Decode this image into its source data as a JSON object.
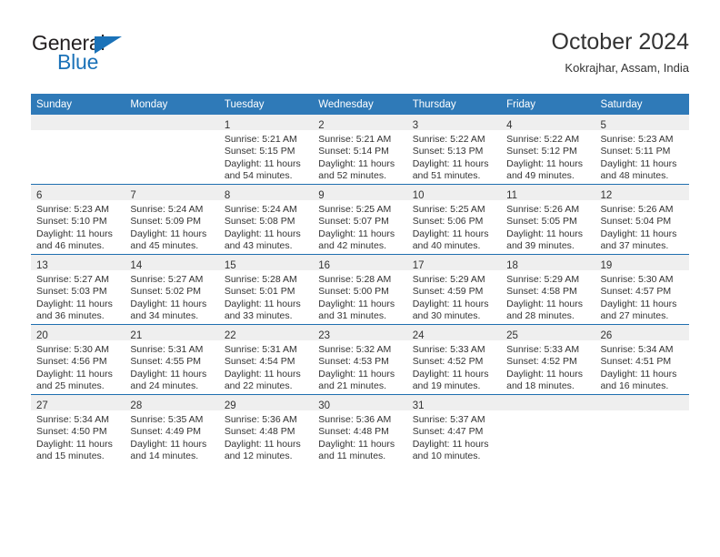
{
  "brand": {
    "name_part1": "General",
    "name_part2": "Blue",
    "triangle_icon": "brand-triangle-icon",
    "accent_color": "#1b72b8"
  },
  "header": {
    "title": "October 2024",
    "subtitle": "Kokrajhar, Assam, India"
  },
  "colors": {
    "header_blue": "#2f7ab8",
    "row_divider_blue": "#1f6fb0",
    "daynum_band_gray": "#efefef",
    "text": "#333333"
  },
  "weekday_headers": [
    "Sunday",
    "Monday",
    "Tuesday",
    "Wednesday",
    "Thursday",
    "Friday",
    "Saturday"
  ],
  "weeks": [
    [
      {
        "day": "",
        "empty": true
      },
      {
        "day": "",
        "empty": true
      },
      {
        "day": "1",
        "sunrise": "Sunrise: 5:21 AM",
        "sunset": "Sunset: 5:15 PM",
        "daylight": "Daylight: 11 hours and 54 minutes."
      },
      {
        "day": "2",
        "sunrise": "Sunrise: 5:21 AM",
        "sunset": "Sunset: 5:14 PM",
        "daylight": "Daylight: 11 hours and 52 minutes."
      },
      {
        "day": "3",
        "sunrise": "Sunrise: 5:22 AM",
        "sunset": "Sunset: 5:13 PM",
        "daylight": "Daylight: 11 hours and 51 minutes."
      },
      {
        "day": "4",
        "sunrise": "Sunrise: 5:22 AM",
        "sunset": "Sunset: 5:12 PM",
        "daylight": "Daylight: 11 hours and 49 minutes."
      },
      {
        "day": "5",
        "sunrise": "Sunrise: 5:23 AM",
        "sunset": "Sunset: 5:11 PM",
        "daylight": "Daylight: 11 hours and 48 minutes."
      }
    ],
    [
      {
        "day": "6",
        "sunrise": "Sunrise: 5:23 AM",
        "sunset": "Sunset: 5:10 PM",
        "daylight": "Daylight: 11 hours and 46 minutes."
      },
      {
        "day": "7",
        "sunrise": "Sunrise: 5:24 AM",
        "sunset": "Sunset: 5:09 PM",
        "daylight": "Daylight: 11 hours and 45 minutes."
      },
      {
        "day": "8",
        "sunrise": "Sunrise: 5:24 AM",
        "sunset": "Sunset: 5:08 PM",
        "daylight": "Daylight: 11 hours and 43 minutes."
      },
      {
        "day": "9",
        "sunrise": "Sunrise: 5:25 AM",
        "sunset": "Sunset: 5:07 PM",
        "daylight": "Daylight: 11 hours and 42 minutes."
      },
      {
        "day": "10",
        "sunrise": "Sunrise: 5:25 AM",
        "sunset": "Sunset: 5:06 PM",
        "daylight": "Daylight: 11 hours and 40 minutes."
      },
      {
        "day": "11",
        "sunrise": "Sunrise: 5:26 AM",
        "sunset": "Sunset: 5:05 PM",
        "daylight": "Daylight: 11 hours and 39 minutes."
      },
      {
        "day": "12",
        "sunrise": "Sunrise: 5:26 AM",
        "sunset": "Sunset: 5:04 PM",
        "daylight": "Daylight: 11 hours and 37 minutes."
      }
    ],
    [
      {
        "day": "13",
        "sunrise": "Sunrise: 5:27 AM",
        "sunset": "Sunset: 5:03 PM",
        "daylight": "Daylight: 11 hours and 36 minutes."
      },
      {
        "day": "14",
        "sunrise": "Sunrise: 5:27 AM",
        "sunset": "Sunset: 5:02 PM",
        "daylight": "Daylight: 11 hours and 34 minutes."
      },
      {
        "day": "15",
        "sunrise": "Sunrise: 5:28 AM",
        "sunset": "Sunset: 5:01 PM",
        "daylight": "Daylight: 11 hours and 33 minutes."
      },
      {
        "day": "16",
        "sunrise": "Sunrise: 5:28 AM",
        "sunset": "Sunset: 5:00 PM",
        "daylight": "Daylight: 11 hours and 31 minutes."
      },
      {
        "day": "17",
        "sunrise": "Sunrise: 5:29 AM",
        "sunset": "Sunset: 4:59 PM",
        "daylight": "Daylight: 11 hours and 30 minutes."
      },
      {
        "day": "18",
        "sunrise": "Sunrise: 5:29 AM",
        "sunset": "Sunset: 4:58 PM",
        "daylight": "Daylight: 11 hours and 28 minutes."
      },
      {
        "day": "19",
        "sunrise": "Sunrise: 5:30 AM",
        "sunset": "Sunset: 4:57 PM",
        "daylight": "Daylight: 11 hours and 27 minutes."
      }
    ],
    [
      {
        "day": "20",
        "sunrise": "Sunrise: 5:30 AM",
        "sunset": "Sunset: 4:56 PM",
        "daylight": "Daylight: 11 hours and 25 minutes."
      },
      {
        "day": "21",
        "sunrise": "Sunrise: 5:31 AM",
        "sunset": "Sunset: 4:55 PM",
        "daylight": "Daylight: 11 hours and 24 minutes."
      },
      {
        "day": "22",
        "sunrise": "Sunrise: 5:31 AM",
        "sunset": "Sunset: 4:54 PM",
        "daylight": "Daylight: 11 hours and 22 minutes."
      },
      {
        "day": "23",
        "sunrise": "Sunrise: 5:32 AM",
        "sunset": "Sunset: 4:53 PM",
        "daylight": "Daylight: 11 hours and 21 minutes."
      },
      {
        "day": "24",
        "sunrise": "Sunrise: 5:33 AM",
        "sunset": "Sunset: 4:52 PM",
        "daylight": "Daylight: 11 hours and 19 minutes."
      },
      {
        "day": "25",
        "sunrise": "Sunrise: 5:33 AM",
        "sunset": "Sunset: 4:52 PM",
        "daylight": "Daylight: 11 hours and 18 minutes."
      },
      {
        "day": "26",
        "sunrise": "Sunrise: 5:34 AM",
        "sunset": "Sunset: 4:51 PM",
        "daylight": "Daylight: 11 hours and 16 minutes."
      }
    ],
    [
      {
        "day": "27",
        "sunrise": "Sunrise: 5:34 AM",
        "sunset": "Sunset: 4:50 PM",
        "daylight": "Daylight: 11 hours and 15 minutes."
      },
      {
        "day": "28",
        "sunrise": "Sunrise: 5:35 AM",
        "sunset": "Sunset: 4:49 PM",
        "daylight": "Daylight: 11 hours and 14 minutes."
      },
      {
        "day": "29",
        "sunrise": "Sunrise: 5:36 AM",
        "sunset": "Sunset: 4:48 PM",
        "daylight": "Daylight: 11 hours and 12 minutes."
      },
      {
        "day": "30",
        "sunrise": "Sunrise: 5:36 AM",
        "sunset": "Sunset: 4:48 PM",
        "daylight": "Daylight: 11 hours and 11 minutes."
      },
      {
        "day": "31",
        "sunrise": "Sunrise: 5:37 AM",
        "sunset": "Sunset: 4:47 PM",
        "daylight": "Daylight: 11 hours and 10 minutes."
      },
      {
        "day": "",
        "empty": true
      },
      {
        "day": "",
        "empty": true
      }
    ]
  ]
}
